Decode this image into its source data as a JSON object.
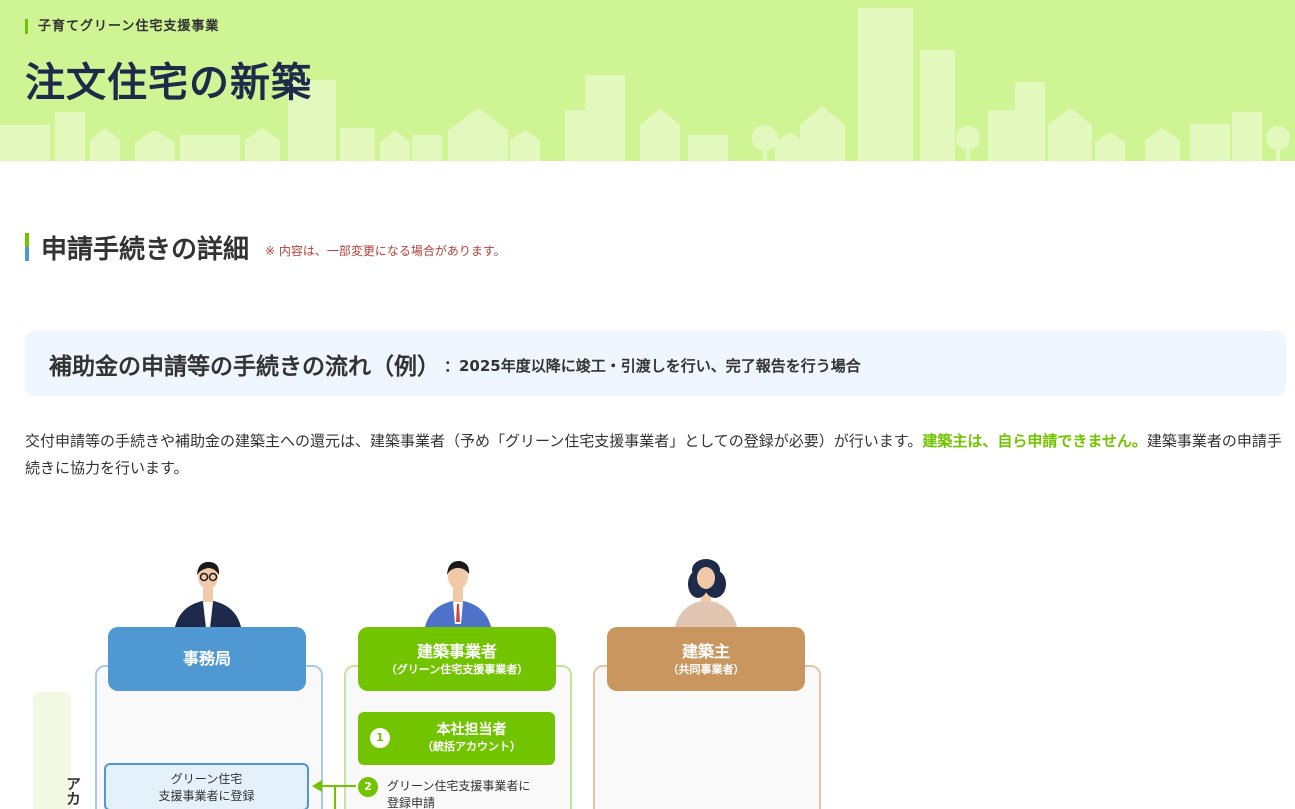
{
  "hero": {
    "breadcrumb": "子育てグリーン住宅支援事業",
    "title": "注文住宅の新築"
  },
  "section": {
    "title": "申請手続きの詳細",
    "note": "※ 内容は、一部変更になる場合があります。"
  },
  "flow": {
    "title": "補助金の申請等の手続きの流れ（例）",
    "subtitle": "：2025年度以降に竣工・引渡しを行い、完了報告を行う場合"
  },
  "lead": {
    "text1": "交付申請等の手続きや補助金の建築主への還元は、建築事業者（予め「グリーン住宅支援事業者」としての登録が必要）が行います。",
    "emphasis": "建築主は、自ら申請できません。",
    "text2": "建築事業者の申請手続きに協力を行います。"
  },
  "diagram": {
    "roles": [
      {
        "name": "事務局",
        "sub": ""
      },
      {
        "name": "建築事業者",
        "sub": "（グリーン住宅支援事業者）"
      },
      {
        "name": "建築主",
        "sub": "（共同事業者）"
      }
    ],
    "side_tab": "アカ",
    "step1": {
      "num": "1",
      "name": "本社担当者",
      "sub": "（統括アカウント）"
    },
    "register_box": {
      "line1": "グリーン住宅",
      "line2": "支援事業者に登録"
    },
    "step2": {
      "num": "2",
      "line1": "グリーン住宅支援事業者に",
      "line2": "登録申請"
    }
  },
  "colors": {
    "hero_bg": "#cff494",
    "accent_green": "#73c400",
    "office_blue": "#4f98d2",
    "owner_brown": "#c9965f",
    "note_red": "#b3413b",
    "title_navy": "#1e2a4a"
  }
}
